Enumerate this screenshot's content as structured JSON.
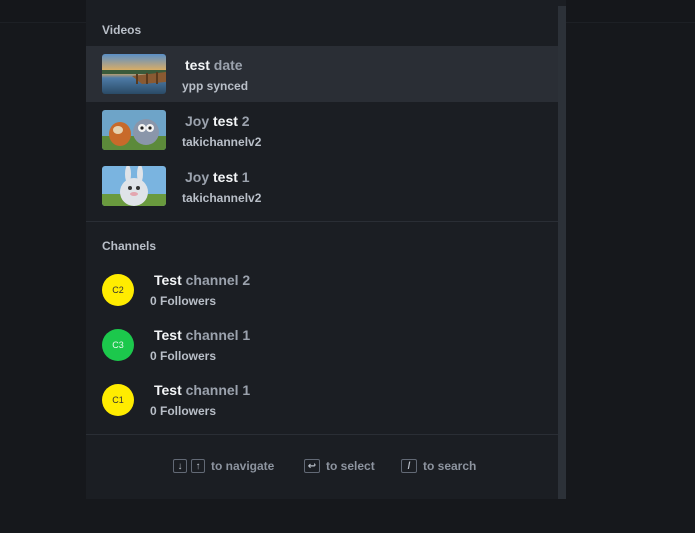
{
  "sections": {
    "videos": {
      "title": "Videos",
      "items": [
        {
          "match": "test",
          "rest": " date",
          "subtitle": "ypp synced",
          "thumbnail": "lake-pier-sunset"
        },
        {
          "prefix": "Joy ",
          "match": "test",
          "rest": " 2",
          "subtitle": "takichannelv2",
          "thumbnail": "cartoon-animals"
        },
        {
          "prefix": "Joy ",
          "match": "test",
          "rest": " 1",
          "subtitle": "takichannelv2",
          "thumbnail": "cartoon-bunny"
        }
      ]
    },
    "channels": {
      "title": "Channels",
      "items": [
        {
          "match": "Test",
          "rest": " channel 2",
          "subtitle": "0 Followers",
          "avatar_text": "C2",
          "avatar_color": "#ffec00"
        },
        {
          "match": "Test",
          "rest": " channel 1",
          "subtitle": "0 Followers",
          "avatar_text": "C3",
          "avatar_color": "#1cc84c"
        },
        {
          "match": "Test",
          "rest": " channel 1",
          "subtitle": "0 Followers",
          "avatar_text": "C1",
          "avatar_color": "#ffec00"
        }
      ]
    }
  },
  "footer": {
    "navigate": {
      "keys": [
        "↓",
        "↑"
      ],
      "label": "to navigate"
    },
    "select": {
      "key": "↩",
      "label": "to select"
    },
    "search": {
      "key": "/",
      "label": "to search"
    }
  },
  "colors": {
    "highlight": "#2a2e35",
    "match_text": "#f3f5f7",
    "rest_text": "#9ba2ad"
  }
}
